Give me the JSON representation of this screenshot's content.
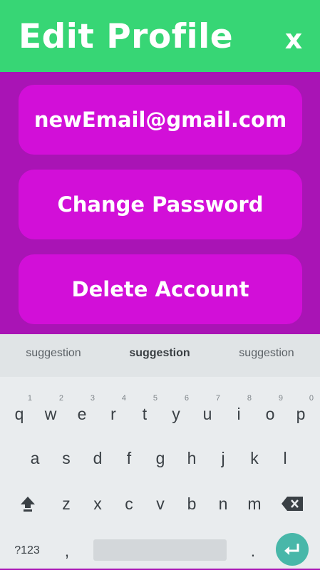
{
  "header": {
    "title": "Edit Profile",
    "close_label": "x"
  },
  "actions": {
    "email": "newEmail@gmail.com",
    "change_password": "Change Password",
    "delete_account": "Delete Account"
  },
  "keyboard": {
    "suggestions": [
      "suggestion",
      "suggestion",
      "suggestion"
    ],
    "row1": [
      {
        "k": "q",
        "n": "1"
      },
      {
        "k": "w",
        "n": "2"
      },
      {
        "k": "e",
        "n": "3"
      },
      {
        "k": "r",
        "n": "4"
      },
      {
        "k": "t",
        "n": "5"
      },
      {
        "k": "y",
        "n": "6"
      },
      {
        "k": "u",
        "n": "7"
      },
      {
        "k": "i",
        "n": "8"
      },
      {
        "k": "o",
        "n": "9"
      },
      {
        "k": "p",
        "n": "0"
      }
    ],
    "row2": [
      "a",
      "s",
      "d",
      "f",
      "g",
      "h",
      "j",
      "k",
      "l"
    ],
    "row3": [
      "z",
      "x",
      "c",
      "v",
      "b",
      "n",
      "m"
    ],
    "symbols_label": "?123",
    "comma": ",",
    "period": "."
  },
  "colors": {
    "header": "#37d675",
    "background": "#a914b5",
    "button": "#d20fd8",
    "enter": "#48b7a9"
  }
}
